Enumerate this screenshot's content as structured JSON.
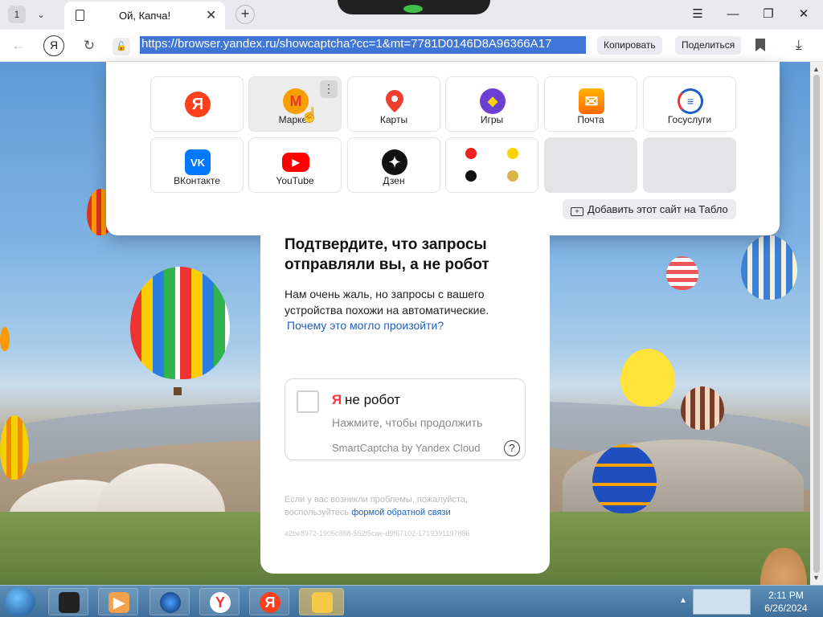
{
  "browser": {
    "tab_count": "1",
    "tab_title": "Ой, Капча!",
    "url": "https://browser.yandex.ru/showcaptcha?cc=1&mt=7781D0146D8A96366A17",
    "copy_label": "Копировать",
    "share_label": "Поделиться"
  },
  "tablo": {
    "tiles": [
      {
        "label": "",
        "icon": "yandex-icon"
      },
      {
        "label": "Маркет",
        "icon": "market-icon"
      },
      {
        "label": "Карты",
        "icon": "maps-icon"
      },
      {
        "label": "Игры",
        "icon": "games-icon"
      },
      {
        "label": "Почта",
        "icon": "mail-icon"
      },
      {
        "label": "Госуслуги",
        "icon": "gosuslugi-icon"
      },
      {
        "label": "ВКонтакте",
        "icon": "vk-icon"
      },
      {
        "label": "YouTube",
        "icon": "youtube-icon"
      },
      {
        "label": "Дзен",
        "icon": "dzen-icon"
      },
      {
        "label": "",
        "icon": "folder-icon"
      },
      {
        "label": "",
        "icon": "empty"
      },
      {
        "label": "",
        "icon": "empty"
      }
    ],
    "add_site_label": "Добавить этот сайт на Табло"
  },
  "captcha": {
    "heading": "Подтвердите, что запросы отправляли вы, а не робот",
    "description": "Нам очень жаль, но запросы с вашего устройства похожи на автоматические.",
    "why_link": "Почему это могло произойти?",
    "ya_letter": "Я",
    "not_robot": "не робот",
    "hint": "Нажмите, чтобы продолжить",
    "brand": "SmartCaptcha by Yandex Cloud",
    "problem_text": "Если у вас возникли проблемы, пожалуйста, воспользуйтесь",
    "problem_link": "формой обратной связи",
    "request_id": "a2be8972-1905c868-552f5cae-d9f67102-1719391197886"
  },
  "taskbar": {
    "time": "2:11 PM",
    "date": "6/26/2024"
  },
  "colors": {
    "yandex_red": "#fc3f1d",
    "link_blue": "#1f5fbf",
    "url_highlight": "#3f76d8"
  }
}
